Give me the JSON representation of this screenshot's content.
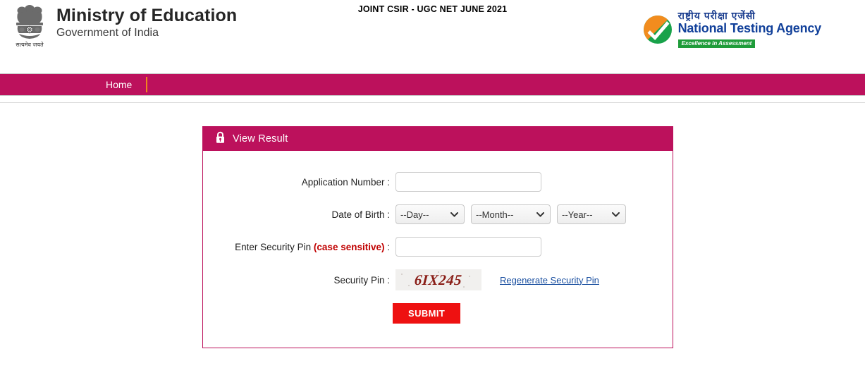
{
  "header": {
    "ministry_title": "Ministry of Education",
    "ministry_subtitle": "Government of India",
    "emblem_motto": "सत्यमेव जयते",
    "exam_title": "JOINT CSIR - UGC NET JUNE 2021",
    "agency": {
      "hindi_name": "राष्ट्रीय  परीक्षा  एजेंसी",
      "english_name": "National Testing Agency",
      "tagline": "Excellence in Assessment"
    }
  },
  "nav": {
    "items": [
      {
        "label": "Home"
      }
    ]
  },
  "panel": {
    "icon": "lock-icon",
    "title": "View Result",
    "fields": {
      "application_number": {
        "label": "Application Number :",
        "value": "",
        "placeholder": ""
      },
      "date_of_birth": {
        "label": "Date of Birth :",
        "day": {
          "selected": "--Day--",
          "options": [
            "--Day--"
          ]
        },
        "month": {
          "selected": "--Month--",
          "options": [
            "--Month--"
          ]
        },
        "year": {
          "selected": "--Year--",
          "options": [
            "--Year--"
          ]
        }
      },
      "enter_security_pin": {
        "label_main": "Enter Security Pin ",
        "label_note": "(case sensitive)",
        "label_colon": " :",
        "value": "",
        "placeholder": ""
      },
      "security_pin": {
        "label": "Security Pin :",
        "captcha_text": "6IX245",
        "regenerate_label": "Regenerate Security Pin"
      }
    },
    "submit_label": "SUBMIT"
  },
  "colors": {
    "brand_magenta": "#bc115c",
    "nav_separator_orange": "#f0861e",
    "submit_red": "#ee1111",
    "link_blue": "#1a4fa0",
    "note_red": "#c00000",
    "agency_blue": "#11409a",
    "tagline_green": "#1f9c3a",
    "captcha_text": "#8a1f18"
  }
}
